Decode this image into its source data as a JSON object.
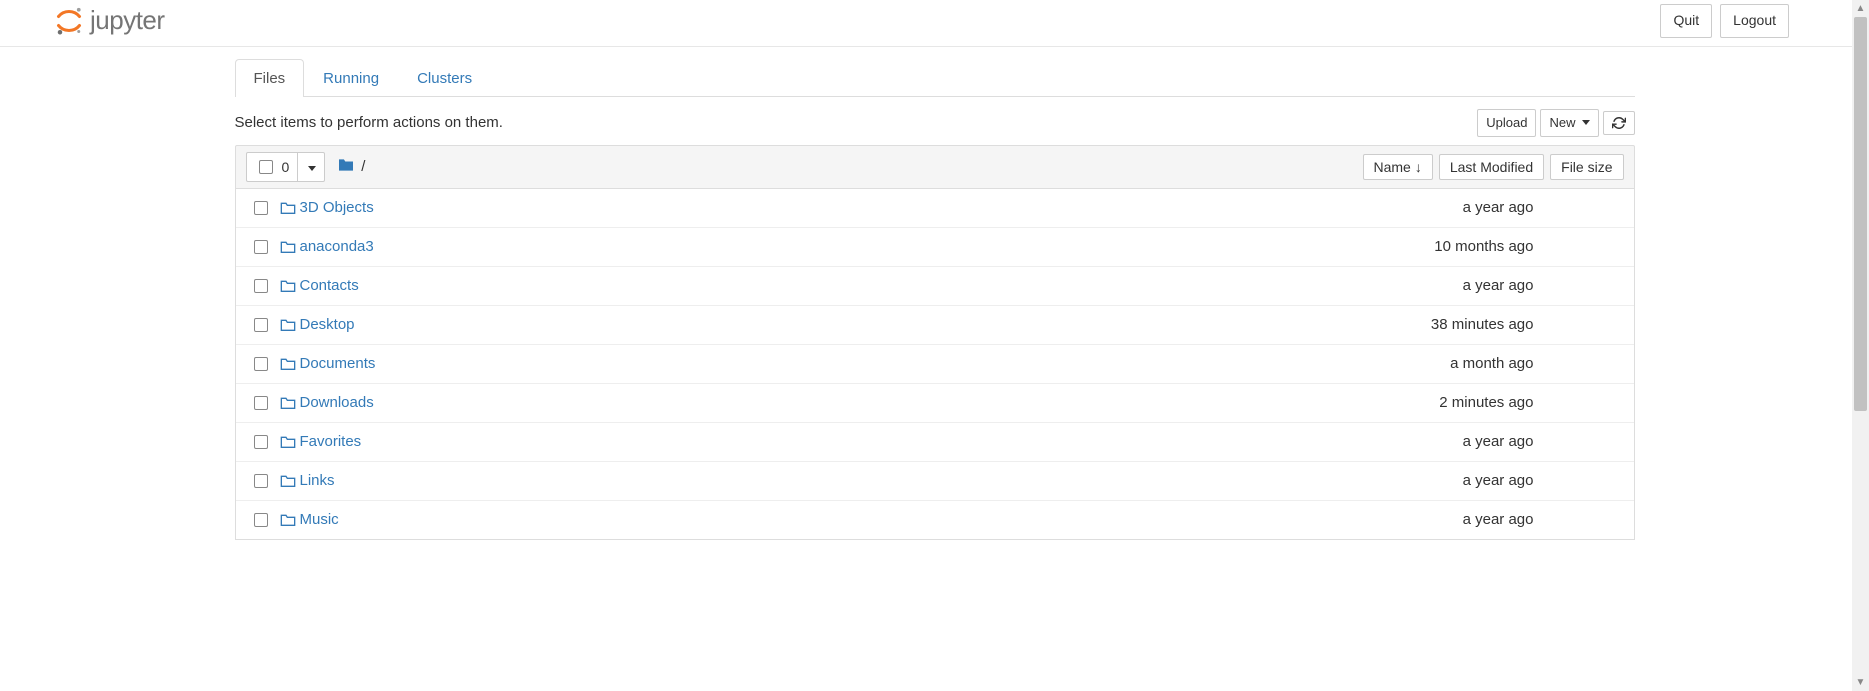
{
  "brand": {
    "name": "jupyter"
  },
  "header": {
    "quit": "Quit",
    "logout": "Logout"
  },
  "tabs": {
    "files": "Files",
    "running": "Running",
    "clusters": "Clusters"
  },
  "toolbar": {
    "hint": "Select items to perform actions on them.",
    "upload": "Upload",
    "new": "New"
  },
  "list_header": {
    "selected_count": "0",
    "breadcrumb_sep": "/",
    "name": "Name",
    "last_modified": "Last Modified",
    "file_size": "File size"
  },
  "files": [
    {
      "name": "3D Objects",
      "modified": "a year ago",
      "size": ""
    },
    {
      "name": "anaconda3",
      "modified": "10 months ago",
      "size": ""
    },
    {
      "name": "Contacts",
      "modified": "a year ago",
      "size": ""
    },
    {
      "name": "Desktop",
      "modified": "38 minutes ago",
      "size": ""
    },
    {
      "name": "Documents",
      "modified": "a month ago",
      "size": ""
    },
    {
      "name": "Downloads",
      "modified": "2 minutes ago",
      "size": ""
    },
    {
      "name": "Favorites",
      "modified": "a year ago",
      "size": ""
    },
    {
      "name": "Links",
      "modified": "a year ago",
      "size": ""
    },
    {
      "name": "Music",
      "modified": "a year ago",
      "size": ""
    }
  ]
}
